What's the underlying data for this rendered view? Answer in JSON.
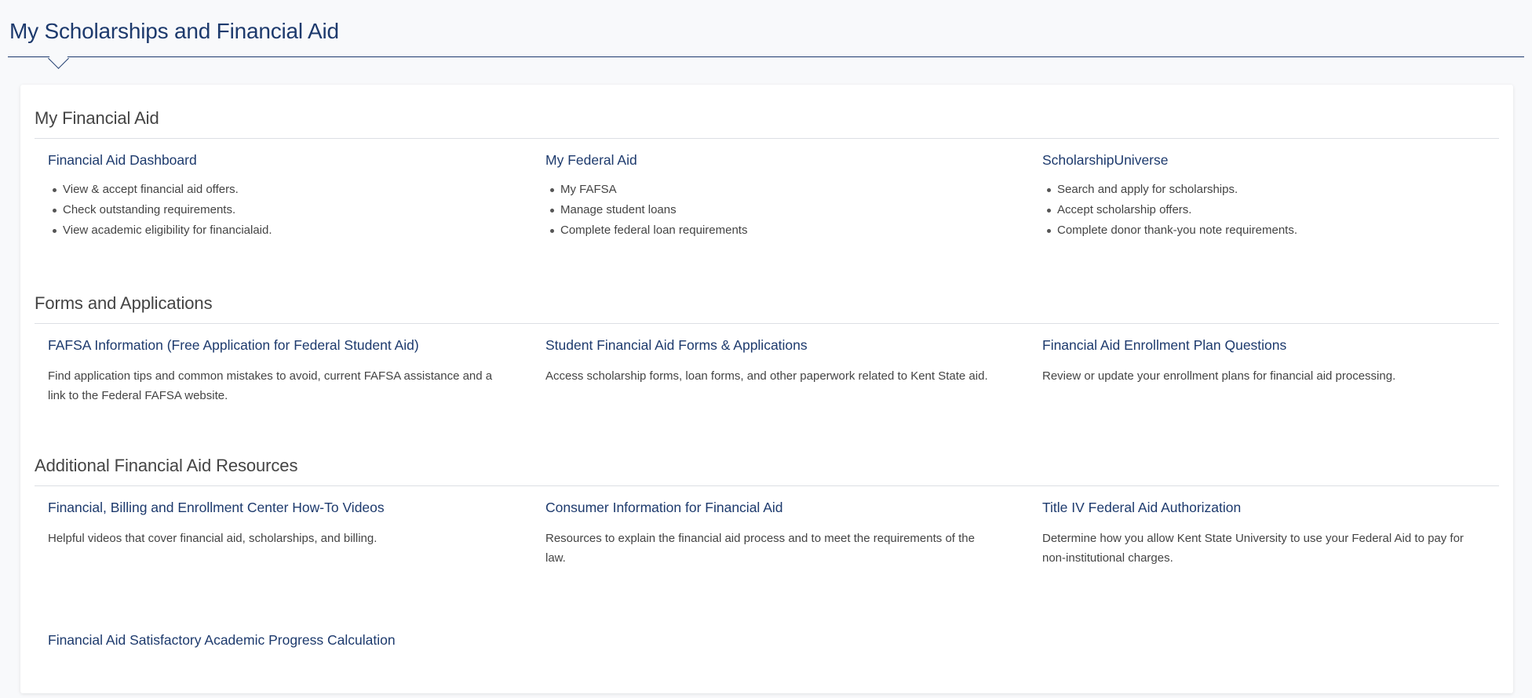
{
  "page": {
    "title": "My Scholarships and Financial Aid"
  },
  "sections": [
    {
      "heading": "My Financial Aid",
      "items": [
        {
          "title": "Financial Aid Dashboard",
          "bullets": [
            "View & accept financial aid offers.",
            "Check outstanding requirements.",
            "View academic eligibility for financialaid."
          ]
        },
        {
          "title": "My Federal Aid",
          "bullets": [
            "My FAFSA",
            "Manage student loans",
            "Complete federal loan requirements"
          ]
        },
        {
          "title": "ScholarshipUniverse",
          "bullets": [
            "Search and apply for scholarships.",
            "Accept scholarship offers.",
            "Complete donor thank-you note requirements."
          ]
        }
      ]
    },
    {
      "heading": "Forms and Applications",
      "items": [
        {
          "title": "FAFSA Information (Free Application for Federal Student Aid)",
          "description": "Find application tips and common mistakes to avoid, current FAFSA assistance and a link to the Federal FAFSA website."
        },
        {
          "title": "Student Financial Aid Forms & Applications",
          "description": "Access scholarship forms, loan forms, and other paperwork related to Kent State aid."
        },
        {
          "title": "Financial Aid Enrollment Plan Questions",
          "description": "Review or update your enrollment plans for financial aid processing."
        }
      ]
    },
    {
      "heading": "Additional Financial Aid Resources",
      "items": [
        {
          "title": "Financial, Billing and Enrollment Center How-To Videos",
          "description": "Helpful videos that cover financial aid, scholarships, and billing."
        },
        {
          "title": "Consumer Information for Financial Aid",
          "description": "Resources to explain the financial aid process and to meet the requirements of the law."
        },
        {
          "title": "Title IV Federal Aid Authorization",
          "description": "Determine how you allow Kent State University to use your Federal Aid to pay for non-institutional charges."
        },
        {
          "title": "Financial Aid Satisfactory Academic Progress Calculation",
          "description": ""
        }
      ]
    }
  ],
  "colors": {
    "primary": "#1d3a6d",
    "text": "#444444",
    "divider": "#dcdfe4"
  }
}
